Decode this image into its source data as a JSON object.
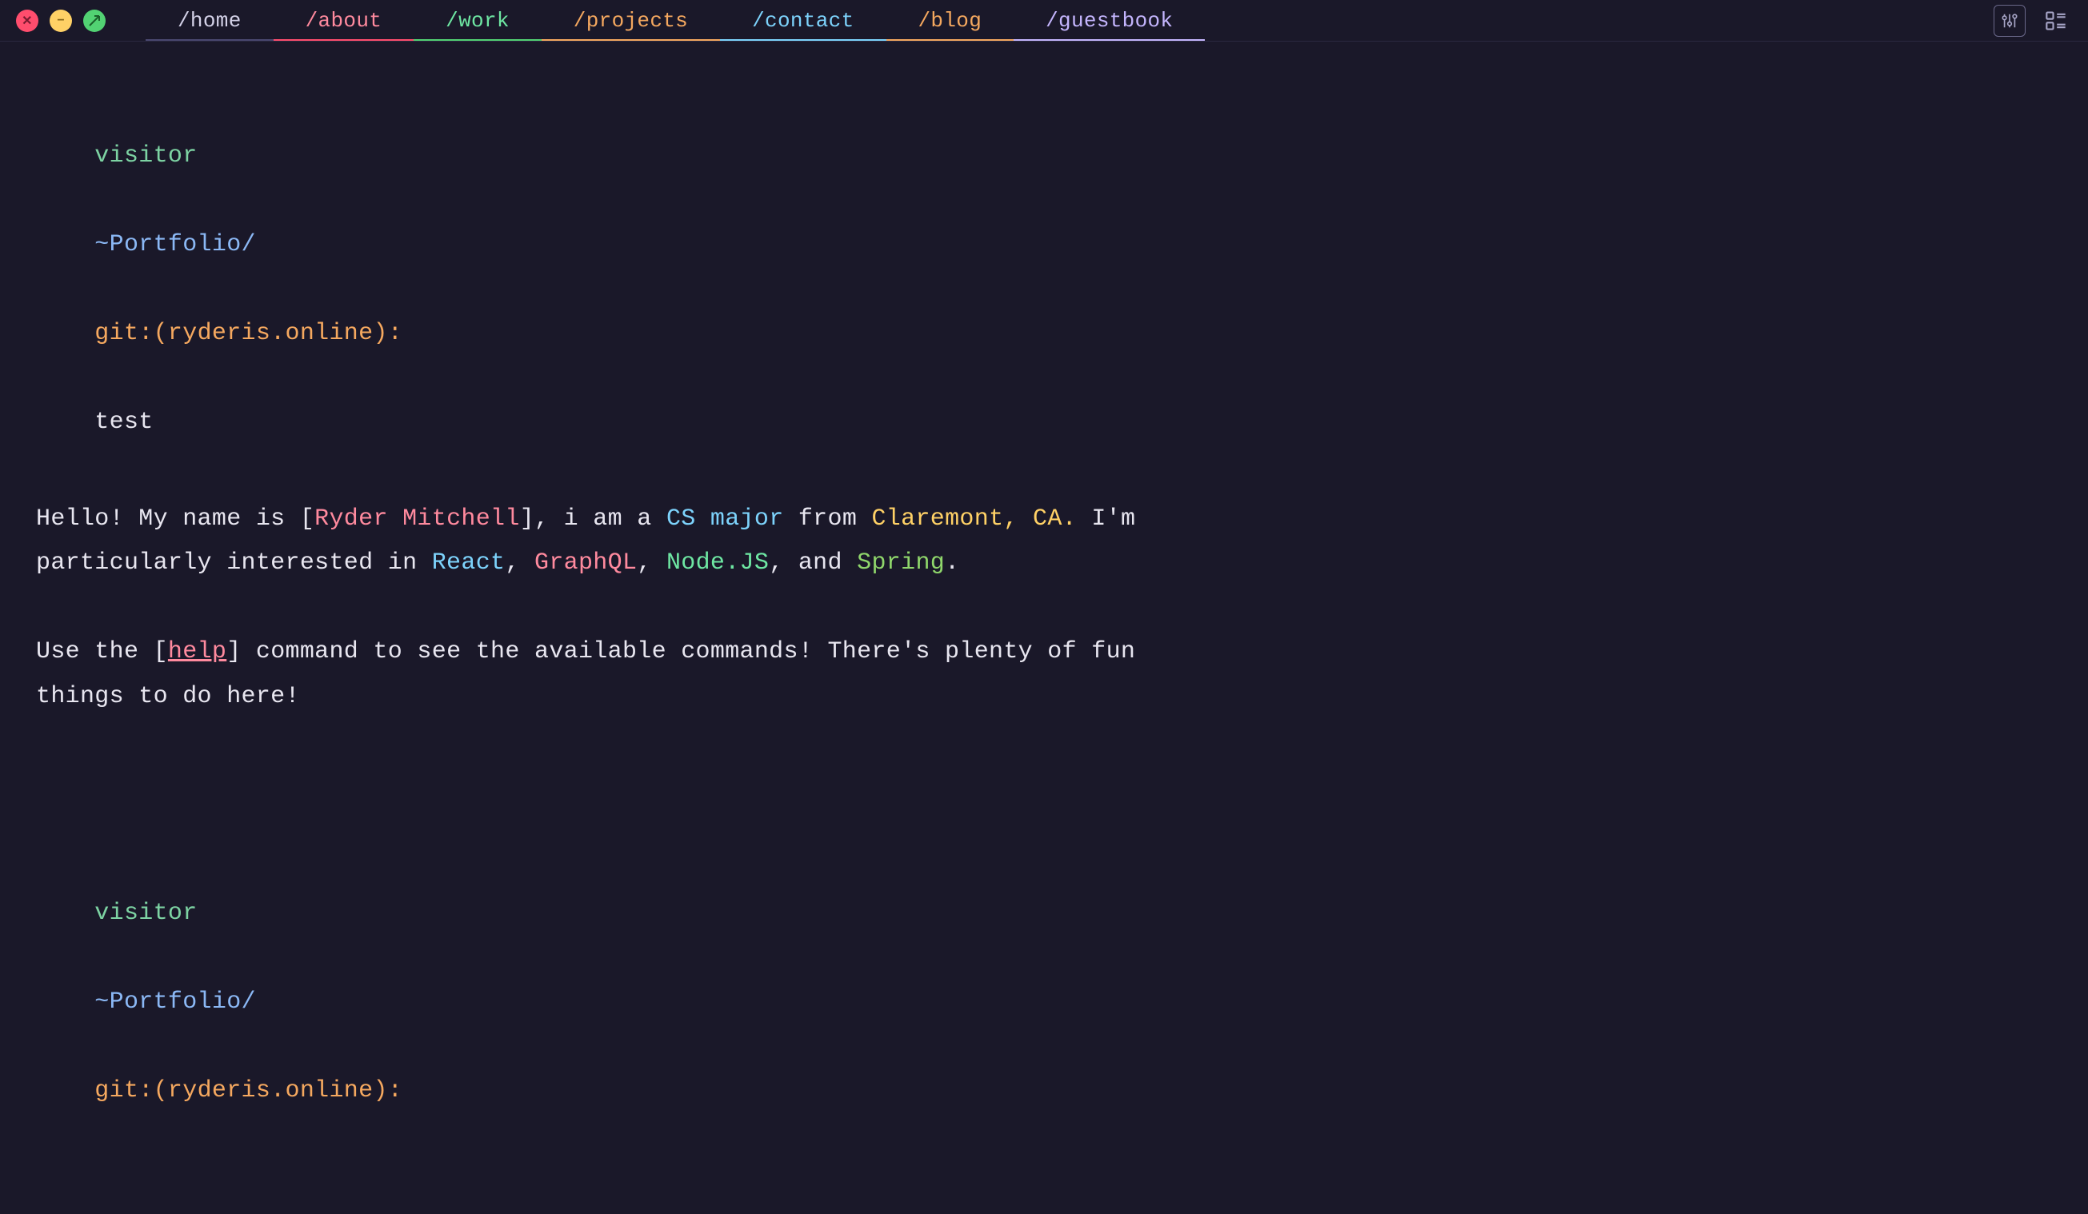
{
  "tabs": [
    {
      "label": "/home",
      "key": "home"
    },
    {
      "label": "/about",
      "key": "about"
    },
    {
      "label": "/work",
      "key": "work"
    },
    {
      "label": "/projects",
      "key": "projects"
    },
    {
      "label": "/contact",
      "key": "contact"
    },
    {
      "label": "/blog",
      "key": "blog"
    },
    {
      "label": "/guestbook",
      "key": "guestbook"
    }
  ],
  "prompt": {
    "user": "visitor",
    "path": "~Portfolio/",
    "git_label": "git:",
    "branch_open": "(",
    "branch": "ryderis.online",
    "branch_close": "):",
    "command": "test"
  },
  "intro": {
    "t1": "Hello! My name is ",
    "bo": "[",
    "name": "Ryder Mitchell",
    "bc": "]",
    "t2": ", i am a ",
    "csmajor": "CS major",
    "t3": " from ",
    "location": "Claremont, CA.",
    "t4": " I'm particularly interested in ",
    "react": "React",
    "c1": ", ",
    "graphql": "GraphQL",
    "c2": ", ",
    "node": "Node.JS",
    "c3": ", and ",
    "spring": "Spring",
    "period": "."
  },
  "hint": {
    "t1": "Use the ",
    "bo": "[",
    "help": "help",
    "bc": "]",
    "t2": " command to see the available commands! There's plenty of fun things to do here!"
  }
}
